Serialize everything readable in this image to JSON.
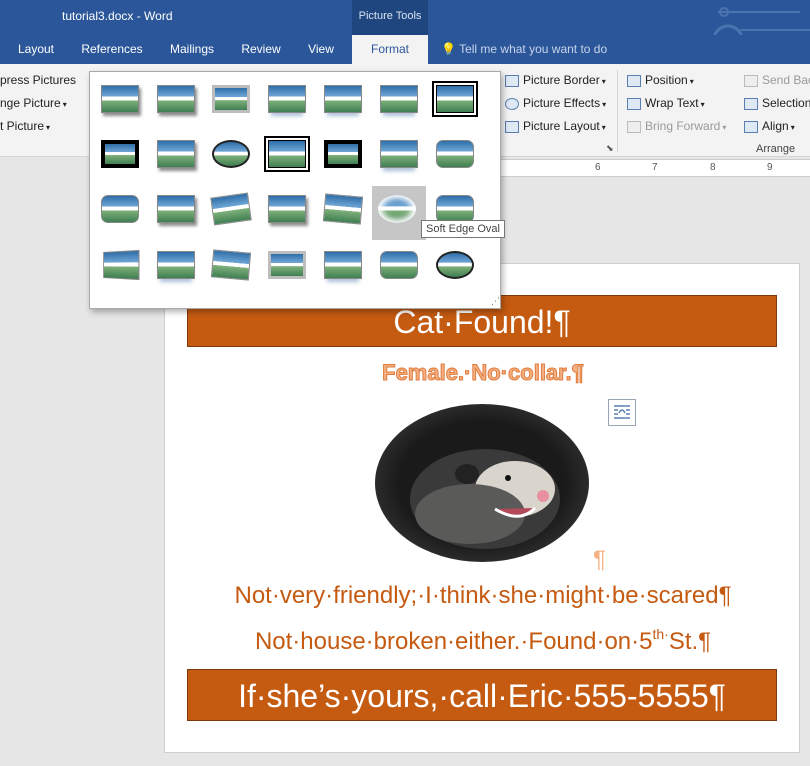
{
  "titlebar": {
    "doc_title": "tutorial3.docx  -  Word",
    "context_tools": "Picture Tools"
  },
  "tabs": [
    {
      "label": "Layout"
    },
    {
      "label": "References"
    },
    {
      "label": "Mailings"
    },
    {
      "label": "Review"
    },
    {
      "label": "View"
    },
    {
      "label": "Format"
    }
  ],
  "tellme": "Tell me what you want to do",
  "ribbon": {
    "adjust": [
      "press Pictures",
      "nge Picture",
      "t Picture"
    ],
    "styles": [
      "Picture Border",
      "Picture Effects",
      "Picture Layout"
    ],
    "arrange": {
      "position": "Position",
      "wrap_text": "Wrap Text",
      "bring_forward": "Bring Forward",
      "send_back": "Send Bac",
      "selection": "Selection",
      "align": "Align",
      "group_label": "Arrange"
    }
  },
  "ruler": {
    "numbers": [
      "6",
      "7",
      "8",
      "9"
    ]
  },
  "gallery": {
    "tooltip": "Soft Edge Oval"
  },
  "document": {
    "banner1": "Cat·Found!¶",
    "subtitle": "Female.·No·collar.¶",
    "pilcrow": "¶",
    "line1": "Not·very·friendly;·I·think·she·might·be·scared¶",
    "line2_a": "Not·house·broken·either.·Found·on·5",
    "line2_sup": "th·",
    "line2_b": "St.¶",
    "banner2": "If·she’s·yours,·call·Eric·555-5555¶"
  },
  "colors": {
    "brand": "#2b579a",
    "banner": "#c55a11",
    "accent_light": "#f4b183"
  }
}
